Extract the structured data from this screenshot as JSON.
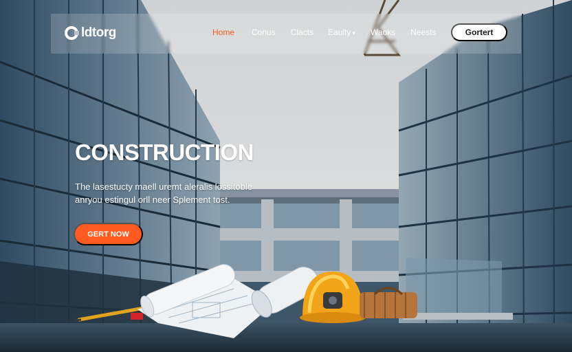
{
  "brand": {
    "name": "ldtorg",
    "logo_icon": "c-logo-icon"
  },
  "nav": {
    "links": [
      {
        "label": "Home",
        "active": true
      },
      {
        "label": "Conus",
        "active": false
      },
      {
        "label": "Clacts",
        "active": false
      },
      {
        "label": "Eaulty",
        "active": false,
        "dropdown": true
      },
      {
        "label": "Waoks",
        "active": false
      },
      {
        "label": "Neests",
        "active": false
      }
    ],
    "dropdown_icon": "chevron-down-icon",
    "contact_label": "Gortert"
  },
  "hero": {
    "title": "CONSTRUCTION",
    "subtitle_line1": "The lasestucty maell uremt aleralis lossitoble",
    "subtitle_line2": "anryou estingul orll neer Splement tost.",
    "cta_label": "GERT NOW"
  },
  "colors": {
    "accent": "#ff5a1f",
    "nav_active": "#ff5a1f",
    "text": "#ffffff"
  },
  "props": [
    "blueprints-image",
    "hard-hat-image",
    "tool-bag-image",
    "pencil-image"
  ]
}
